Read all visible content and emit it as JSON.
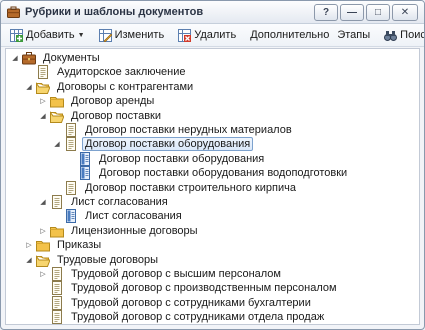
{
  "window": {
    "title": "Рубрики и шаблоны документов",
    "buttons": {
      "help": "?",
      "minimize": "—",
      "maximize": "□",
      "close": "✕"
    }
  },
  "toolbar": {
    "add": "Добавить",
    "edit": "Изменить",
    "delete": "Удалить",
    "additional": "Дополнительно",
    "stages": "Этапы",
    "search": "Поиск..."
  },
  "tree": [
    {
      "label": "Документы",
      "level": 0,
      "icon": "briefcase-icon",
      "expander": "expanded"
    },
    {
      "label": "Аудиторское заключение",
      "level": 1,
      "icon": "document-icon",
      "expander": "none"
    },
    {
      "label": "Договоры с контрагентами",
      "level": 1,
      "icon": "folder-open-icon",
      "expander": "expanded"
    },
    {
      "label": "Договор аренды",
      "level": 2,
      "icon": "folder-icon",
      "expander": "collapsed"
    },
    {
      "label": "Договор поставки",
      "level": 2,
      "icon": "folder-open-icon",
      "expander": "expanded"
    },
    {
      "label": "Договор поставки нерудных материалов",
      "level": 3,
      "icon": "document-icon",
      "expander": "none"
    },
    {
      "label": "Договор поставки оборудования",
      "level": 3,
      "icon": "document-icon",
      "expander": "expanded",
      "selected": true
    },
    {
      "label": "Договор поставки оборудования",
      "level": 4,
      "icon": "template-icon",
      "expander": "none"
    },
    {
      "label": "Договор поставки оборудования водоподготовки",
      "level": 4,
      "icon": "template-icon",
      "expander": "none"
    },
    {
      "label": "Договор поставки строительного кирпича",
      "level": 3,
      "icon": "document-icon",
      "expander": "none"
    },
    {
      "label": "Лист согласования",
      "level": 2,
      "icon": "document-icon",
      "expander": "expanded"
    },
    {
      "label": "Лист согласования",
      "level": 3,
      "icon": "template-icon",
      "expander": "none"
    },
    {
      "label": "Лицензионные договоры",
      "level": 2,
      "icon": "folder-icon",
      "expander": "collapsed"
    },
    {
      "label": "Приказы",
      "level": 1,
      "icon": "folder-icon",
      "expander": "collapsed"
    },
    {
      "label": "Трудовые договоры",
      "level": 1,
      "icon": "folder-open-icon",
      "expander": "expanded"
    },
    {
      "label": "Трудовой договор с высшим персоналом",
      "level": 2,
      "icon": "document-icon",
      "expander": "collapsed"
    },
    {
      "label": "Трудовой договор с производственным персоналом",
      "level": 2,
      "icon": "document-icon",
      "expander": "none"
    },
    {
      "label": "Трудовой договор с сотрудниками бухгалтерии",
      "level": 2,
      "icon": "document-icon",
      "expander": "none"
    },
    {
      "label": "Трудовой договор с сотрудниками отдела продаж",
      "level": 2,
      "icon": "document-icon",
      "expander": "none"
    }
  ]
}
